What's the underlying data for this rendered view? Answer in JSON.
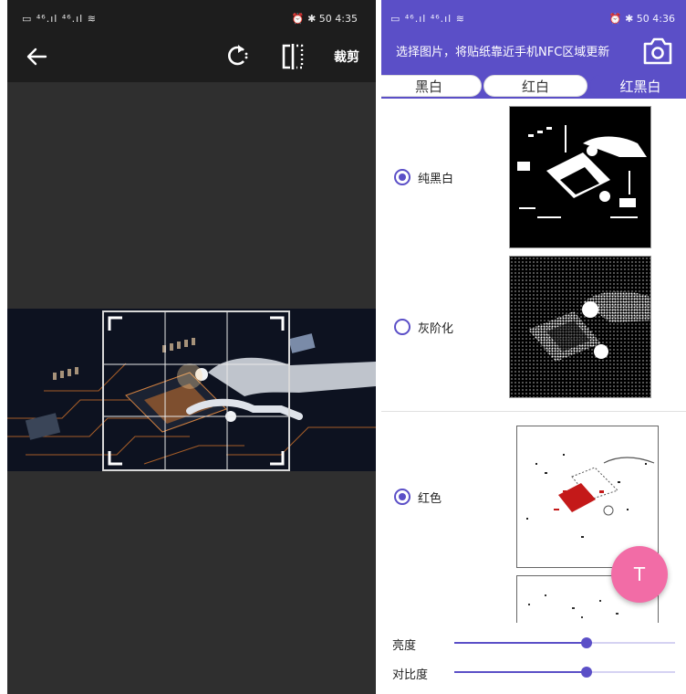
{
  "left_screen": {
    "status_left": "▭ ⁴⁶.ıl ⁴⁶.ıl ≋",
    "status_right": "⏰ ✱ 50 4:35",
    "toolbar": {
      "crop_label": "裁剪"
    }
  },
  "right_screen": {
    "status_left": "▭ ⁴⁶.ıl ⁴⁶.ıl ≋",
    "status_right": "⏰ ✱ 50 4:36",
    "app_title": "选择图片，将贴纸靠近手机NFC区域更新",
    "tabs": [
      {
        "label": "黑白"
      },
      {
        "label": "红白"
      },
      {
        "label": "红黑白"
      }
    ],
    "selected_tab": "红黑白",
    "options": [
      {
        "label": "纯黑白",
        "selected": true
      },
      {
        "label": "灰阶化",
        "selected": false
      },
      {
        "label": "红色",
        "selected": true
      }
    ],
    "fab_label": "T",
    "sliders": [
      {
        "label": "亮度",
        "value": 0.6
      },
      {
        "label": "对比度",
        "value": 0.6
      }
    ],
    "accent_color": "#5b4fc7",
    "fab_color": "#f26ca6"
  }
}
